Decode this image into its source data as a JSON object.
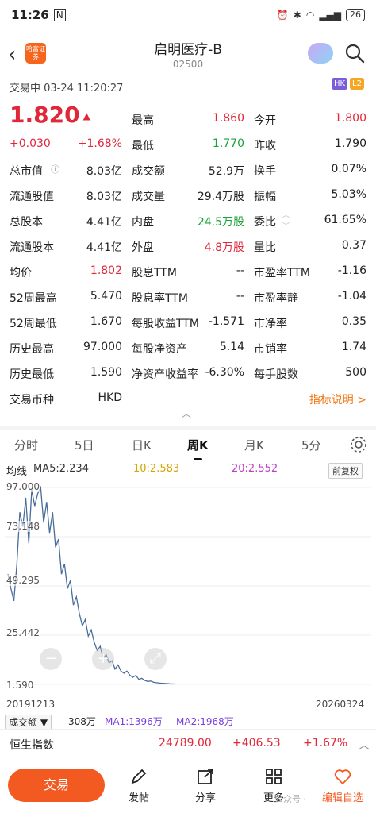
{
  "status_bar": {
    "time": "11:26",
    "icon_glyph": "N",
    "battery": "26"
  },
  "header": {
    "brand_logo": "哈富证券",
    "title": "启明医疗-B",
    "code": "02500"
  },
  "trade_status": "交易中  03-24 11:20:27",
  "badges": {
    "hk": "HK",
    "l2": "L2"
  },
  "price": {
    "last": "1.820",
    "change": "+0.030",
    "change_pct": "+1.68%"
  },
  "quote_rows": [
    {
      "l1": "",
      "v1": "",
      "l2": "最高",
      "v2": "1.860",
      "l3": "今开",
      "v3": "1.800"
    },
    {
      "l1": "",
      "v1": "",
      "l2": "最低",
      "v2": "1.770",
      "l3": "昨收",
      "v3": "1.790"
    },
    {
      "l1": "总市值",
      "v1": "8.03亿",
      "l2": "成交额",
      "v2": "52.9万",
      "l3": "换手",
      "v3": "0.07%"
    },
    {
      "l1": "流通股值",
      "v1": "8.03亿",
      "l2": "成交量",
      "v2": "29.4万股",
      "l3": "振幅",
      "v3": "5.03%"
    },
    {
      "l1": "总股本",
      "v1": "4.41亿",
      "l2": "内盘",
      "v2": "24.5万股",
      "l3": "委比",
      "v3": "61.65%"
    },
    {
      "l1": "流通股本",
      "v1": "4.41亿",
      "l2": "外盘",
      "v2": "4.8万股",
      "l3": "量比",
      "v3": "0.37"
    },
    {
      "l1": "均价",
      "v1": "1.802",
      "l2": "股息TTM",
      "v2": "--",
      "l3": "市盈率TTM",
      "v3": "-1.16"
    },
    {
      "l1": "52周最高",
      "v1": "5.470",
      "l2": "股息率TTM",
      "v2": "--",
      "l3": "市盈率静",
      "v3": "-1.04"
    },
    {
      "l1": "52周最低",
      "v1": "1.670",
      "l2": "每股收益TTM",
      "v2": "-1.571",
      "l3": "市净率",
      "v3": "0.35"
    },
    {
      "l1": "历史最高",
      "v1": "97.000",
      "l2": "每股净资产",
      "v2": "5.14",
      "l3": "市销率",
      "v3": "1.74"
    },
    {
      "l1": "历史最低",
      "v1": "1.590",
      "l2": "净资产收益率",
      "v2": "-6.30%",
      "l3": "每手股数",
      "v3": "500"
    },
    {
      "l1": "交易币种",
      "v1": "HKD",
      "l2": "",
      "v2": "",
      "l3": "",
      "v3": ""
    }
  ],
  "help_link": "指标说明 >",
  "tabs": [
    "分时",
    "5日",
    "日K",
    "周K",
    "月K",
    "5分"
  ],
  "active_tab": "周K",
  "ma": {
    "label": "均线",
    "ma5": "MA5:2.234",
    "ma10": "10:2.583",
    "ma20": "20:2.552",
    "adjust": "前复权"
  },
  "chart": {
    "y_ticks": [
      "97.000",
      "73.148",
      "49.295",
      "25.442",
      "1.590"
    ],
    "start_date": "20191213",
    "end_date": "20260324"
  },
  "chart_data": {
    "type": "line",
    "ylim": [
      1.59,
      97.0
    ],
    "x": [
      "20191213",
      "20260324"
    ],
    "values": [
      55,
      48,
      42,
      60,
      85,
      78,
      92,
      70,
      96,
      88,
      94,
      97,
      80,
      90,
      75,
      85,
      68,
      72,
      55,
      60,
      48,
      52,
      40,
      44,
      36,
      30,
      33,
      25,
      28,
      22,
      18,
      20,
      14,
      16,
      12,
      13,
      9,
      11,
      8,
      7,
      8,
      6,
      5,
      6,
      4,
      4.5,
      3.5,
      3,
      3.2,
      2.6,
      2.4,
      2.2,
      2.1,
      2.0,
      1.9,
      1.8,
      1.82
    ]
  },
  "volume_bar": {
    "select": "成交额 ▼",
    "value": "308万",
    "ma1": "MA1:1396万",
    "ma2": "MA2:1968万"
  },
  "index_row": {
    "name": "恒生指数",
    "value": "24789.00",
    "change": "+406.53",
    "pct": "+1.67%"
  },
  "bottom_nav": {
    "trade": "交易",
    "post": "发帖",
    "share": "分享",
    "more": "更多",
    "fav": "编辑自选"
  },
  "watermark": "公众号 ·"
}
